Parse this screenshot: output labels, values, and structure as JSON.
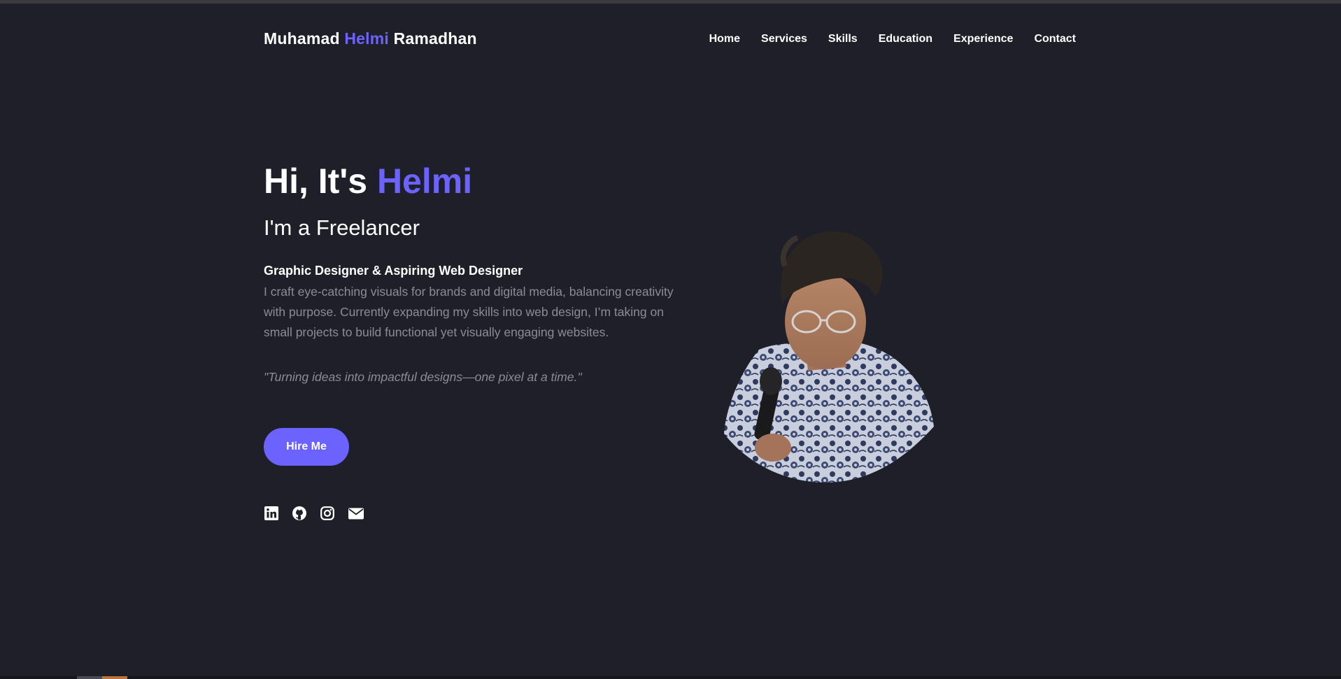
{
  "header": {
    "logo_first": "Muhamad",
    "logo_accent": "Helmi",
    "logo_last": "Ramadhan",
    "nav": [
      {
        "label": "Home"
      },
      {
        "label": "Services"
      },
      {
        "label": "Skills"
      },
      {
        "label": "Education"
      },
      {
        "label": "Experience"
      },
      {
        "label": "Contact"
      }
    ]
  },
  "hero": {
    "greeting": "Hi, It's",
    "name": "Helmi",
    "role": "I'm a Freelancer",
    "subtitle": "Graphic Designer & Aspiring Web Designer",
    "description": "I craft eye-catching visuals for brands and digital media, balancing creativity with purpose. Currently expanding my skills into web design, I’m taking on small projects to build functional yet visually engaging websites.",
    "quote": "\"Turning ideas into impactful designs—one pixel at a time.\"",
    "cta_label": "Hire Me"
  },
  "socials": [
    {
      "icon": "linkedin-icon"
    },
    {
      "icon": "github-icon"
    },
    {
      "icon": "instagram-icon"
    },
    {
      "icon": "email-icon"
    }
  ],
  "colors": {
    "background": "#1f1f29",
    "accent": "#6c63ff",
    "muted_text": "#8c8c96",
    "text": "#ffffff"
  }
}
